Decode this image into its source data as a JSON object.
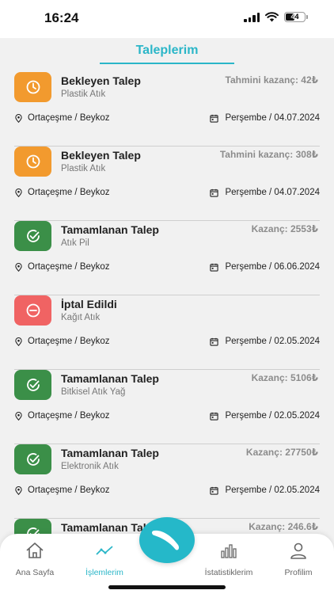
{
  "status_bar": {
    "time": "16:24",
    "battery": "44"
  },
  "page": {
    "title": "Taleplerim"
  },
  "requests": [
    {
      "status": "pending",
      "title": "Bekleyen Talep",
      "type": "Plastik Atık",
      "earning": "Tahmini kazanç: 42₺",
      "location": "Ortaçeşme / Beykoz",
      "date": "Perşembe / 04.07.2024"
    },
    {
      "status": "pending",
      "title": "Bekleyen Talep",
      "type": "Plastik Atık",
      "earning": "Tahmini kazanç: 308₺",
      "location": "Ortaçeşme / Beykoz",
      "date": "Perşembe / 04.07.2024"
    },
    {
      "status": "done",
      "title": "Tamamlanan Talep",
      "type": "Atık Pil",
      "earning": "Kazanç: 2553₺",
      "location": "Ortaçeşme / Beykoz",
      "date": "Perşembe / 06.06.2024"
    },
    {
      "status": "cancelled",
      "title": "İptal Edildi",
      "type": "Kağıt Atık",
      "earning": "",
      "location": "Ortaçeşme / Beykoz",
      "date": "Perşembe / 02.05.2024"
    },
    {
      "status": "done",
      "title": "Tamamlanan Talep",
      "type": "Bitkisel Atık Yağ",
      "earning": "Kazanç: 5106₺",
      "location": "Ortaçeşme / Beykoz",
      "date": "Perşembe / 02.05.2024"
    },
    {
      "status": "done",
      "title": "Tamamlanan Talep",
      "type": "Elektronik Atık",
      "earning": "Kazanç: 27750₺",
      "location": "Ortaçeşme / Beykoz",
      "date": "Perşembe / 02.05.2024"
    },
    {
      "status": "done",
      "title": "Tamamlanan Talep",
      "type": "",
      "earning": "Kazanç: 246.6₺",
      "location": "",
      "date": ""
    }
  ],
  "status_colors": {
    "pending": "#f29a2e",
    "done": "#3b8f48",
    "cancelled": "#f06363",
    "accent": "#2bb6c8"
  },
  "tabbar": {
    "home": {
      "label": "Ana Sayfa",
      "icon": "home-icon"
    },
    "transactions": {
      "label": "İşlemlerim",
      "icon": "trend-line-icon",
      "active": true
    },
    "center": {
      "icon": "boomerang-icon"
    },
    "stats": {
      "label": "İstatistiklerim",
      "icon": "bar-chart-icon"
    },
    "profile": {
      "label": "Profilim",
      "icon": "user-icon"
    }
  }
}
